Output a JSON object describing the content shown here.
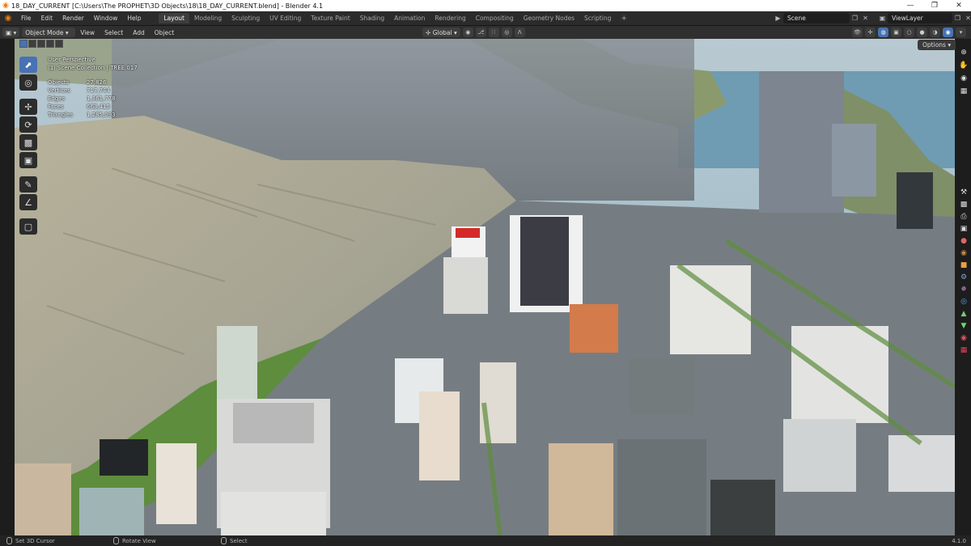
{
  "window": {
    "title": "18_DAY_CURRENT [C:\\Users\\The PROPHET\\3D Objects\\18\\18_DAY_CURRENT.blend] - Blender 4.1",
    "controls": [
      "—",
      "❐",
      "✕"
    ]
  },
  "menu": {
    "items": [
      "File",
      "Edit",
      "Render",
      "Window",
      "Help"
    ]
  },
  "workspaces": {
    "tabs": [
      "Layout",
      "Modeling",
      "Sculpting",
      "UV Editing",
      "Texture Paint",
      "Shading",
      "Animation",
      "Rendering",
      "Compositing",
      "Geometry Nodes",
      "Scripting"
    ],
    "active": "Layout",
    "add_label": "+"
  },
  "scene": {
    "name": "Scene"
  },
  "view_layer": {
    "name": "ViewLayer"
  },
  "viewport_header": {
    "mode": "Object Mode",
    "menus": [
      "View",
      "Select",
      "Add",
      "Object"
    ],
    "orientation": "Global",
    "options_label": "Options"
  },
  "overlay": {
    "perspective": "User Perspective",
    "collection": "(1) Scene Collection | TREE.017",
    "stats": [
      {
        "label": "Objects",
        "value": "27,826"
      },
      {
        "label": "Vertices",
        "value": "717,744"
      },
      {
        "label": "Edges",
        "value": "1,361,778"
      },
      {
        "label": "Faces",
        "value": "663,415"
      },
      {
        "label": "Triangles",
        "value": "1,285,093"
      }
    ]
  },
  "status": {
    "left": "Set 3D Cursor",
    "middle": "Rotate View",
    "right": "Select",
    "version": "4.1.0"
  },
  "colors": {
    "accent": "#4772b3",
    "blender_orange": "#e87d0d"
  }
}
